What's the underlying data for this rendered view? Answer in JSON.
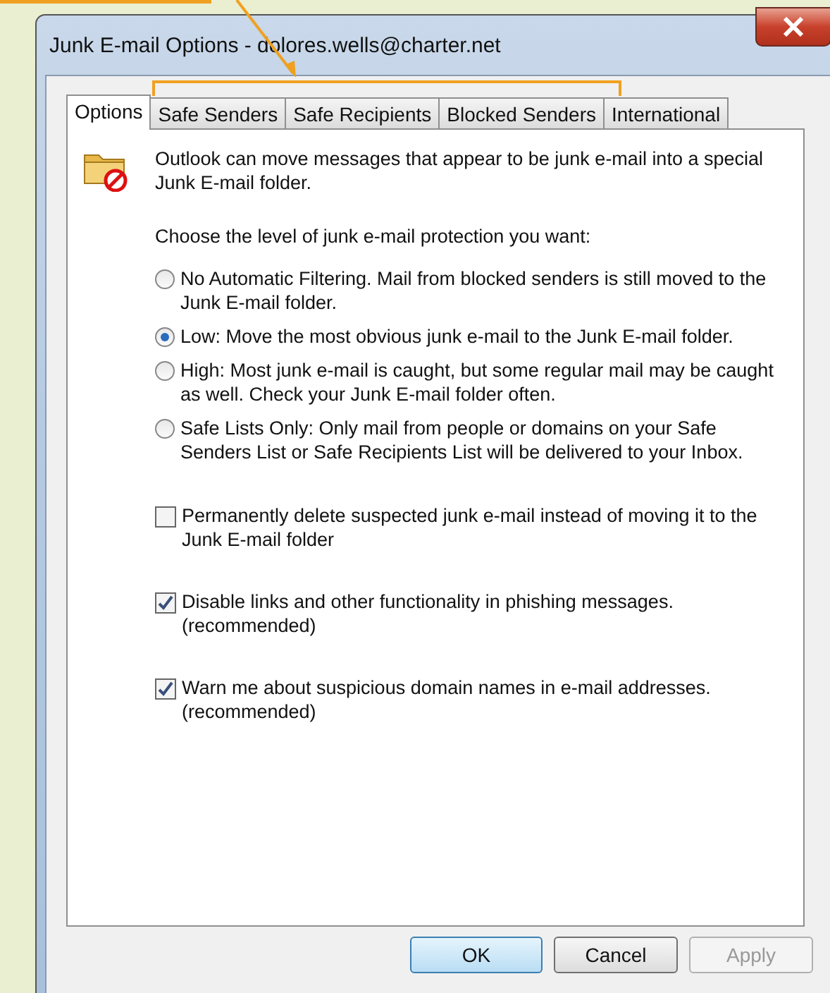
{
  "window": {
    "title": "Junk E-mail Options - dolores.wells@charter.net"
  },
  "tabs": [
    {
      "label": "Options",
      "selected": true
    },
    {
      "label": "Safe Senders",
      "selected": false
    },
    {
      "label": "Safe Recipients",
      "selected": false
    },
    {
      "label": "Blocked Senders",
      "selected": false
    },
    {
      "label": "International",
      "selected": false
    }
  ],
  "intro": "Outlook can move messages that appear to be junk e-mail into a special Junk E-mail folder.",
  "prompt": "Choose the level of junk e-mail protection you want:",
  "protection_levels": [
    {
      "label": "No Automatic Filtering. Mail from blocked senders is still moved to the Junk E-mail folder.",
      "selected": false
    },
    {
      "label": "Low: Move the most obvious junk e-mail to the Junk E-mail folder.",
      "selected": true
    },
    {
      "label": "High: Most junk e-mail is caught, but some regular mail may be caught as well. Check your Junk E-mail folder often.",
      "selected": false
    },
    {
      "label": "Safe Lists Only: Only mail from people or domains on your Safe Senders List or Safe Recipients List will be delivered to your Inbox.",
      "selected": false
    }
  ],
  "options": [
    {
      "label": "Permanently delete suspected junk e-mail instead of moving it to the Junk E-mail folder",
      "checked": false
    },
    {
      "label": "Disable links and other functionality in phishing messages. (recommended)",
      "checked": true
    },
    {
      "label": "Warn me about suspicious domain names in e-mail addresses. (recommended)",
      "checked": true
    }
  ],
  "buttons": [
    {
      "label": "OK",
      "default": true,
      "disabled": false
    },
    {
      "label": "Cancel",
      "default": false,
      "disabled": false
    },
    {
      "label": "Apply",
      "default": false,
      "disabled": true
    }
  ]
}
